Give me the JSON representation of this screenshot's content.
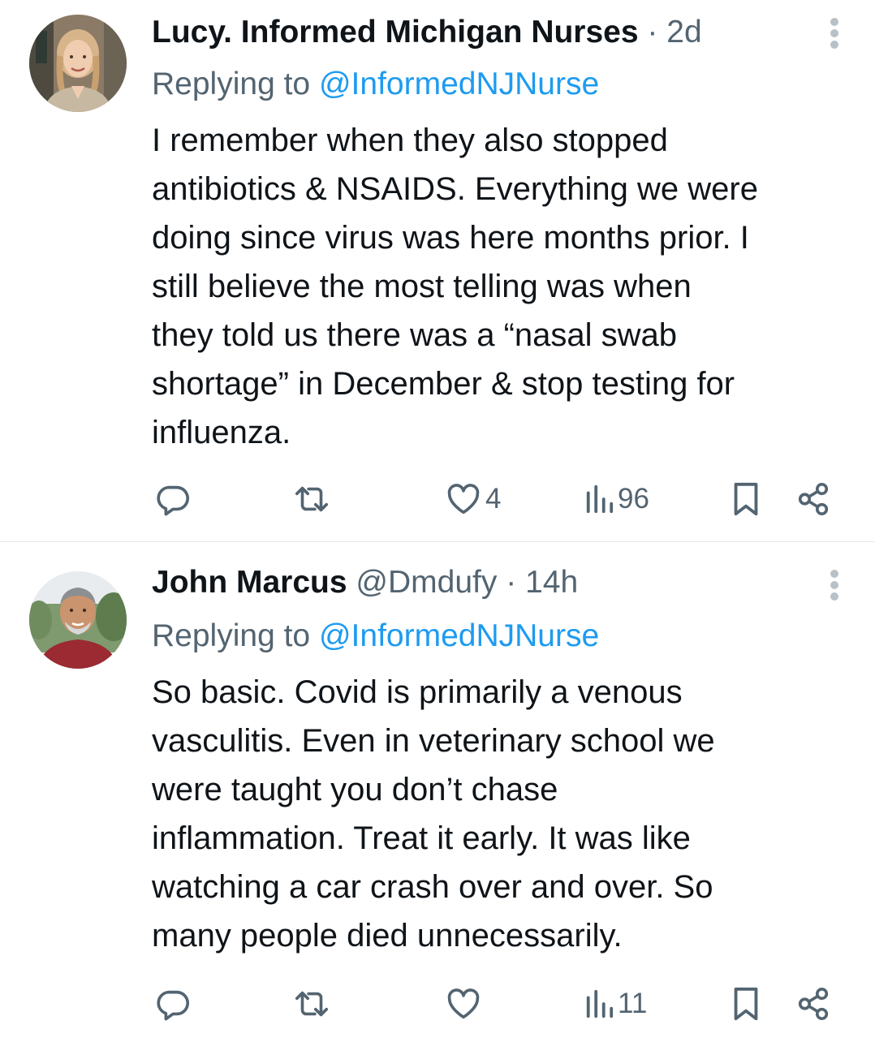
{
  "tweets": [
    {
      "display_name": "Lucy. Informed Michigan Nurses",
      "handle": "",
      "separator": "·",
      "time": "2d",
      "replying_prefix": "Replying to",
      "replying_handle": "@InformedNJNurse",
      "body_lines": [
        "I remember when they also stopped",
        "antibiotics & NSAIDS. Everything we were",
        "doing since virus was here months prior. I",
        "still believe the most telling was when",
        "they told us there was a “nasal swab",
        "shortage” in December & stop testing for",
        "influenza."
      ],
      "likes": "4",
      "views": "96"
    },
    {
      "display_name": "John Marcus",
      "handle": "@Dmdufy",
      "separator": "·",
      "time": "14h",
      "replying_prefix": "Replying to",
      "replying_handle": "@InformedNJNurse",
      "body_lines": [
        "So basic. Covid is primarily a venous",
        "vasculitis. Even in veterinary school we",
        "were taught you don’t chase",
        "inflammation. Treat it early. It was like",
        "watching a car crash over and over. So",
        "many people died unnecessarily."
      ],
      "likes": "",
      "views": "11"
    }
  ],
  "colors": {
    "text": "#0f1419",
    "secondary": "#536471",
    "link": "#1d9bf0",
    "divider": "#e3e6e9"
  },
  "icons": [
    "reply-icon",
    "retweet-icon",
    "heart-icon",
    "views-icon",
    "bookmark-icon",
    "share-icon",
    "more-icon"
  ]
}
